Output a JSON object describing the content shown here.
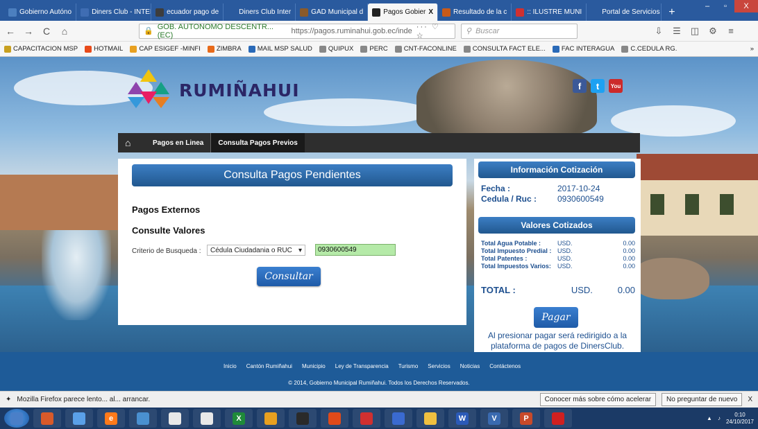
{
  "browser": {
    "tabs": [
      {
        "label": "Gobierno Autóno",
        "color": "#4c7fbf"
      },
      {
        "label": "Diners Club - INTERD",
        "color": "#3f6db3"
      },
      {
        "label": "ecuador pago de",
        "color": "#3d3d3d"
      },
      {
        "label": "Diners Club Inter",
        "color": "#2a5a9e"
      },
      {
        "label": "GAD Municipal d",
        "color": "#8a5a2a"
      },
      {
        "label": "Pagos Gobier",
        "color": "#222222"
      },
      {
        "label": "Resultado de la c",
        "color": "#c85a1a"
      },
      {
        "label": ":: ILUSTRE MUNI",
        "color": "#d03030"
      },
      {
        "label": "Portal de Servicios C",
        "color": "#2a5a9e"
      }
    ],
    "active_tab_close": "X",
    "new_tab": "+",
    "window_controls": [
      "–",
      "▫",
      "X"
    ],
    "back": "←",
    "forward": "→",
    "reload": "C",
    "home": "⌂",
    "url_org": "GOB. AUTONOMO DESCENTR... (EC)",
    "url": "https://pagos.ruminahui.gob.ec/inde",
    "url_actions": "··· ♡ ☆",
    "search_placeholder": "Buscar",
    "bookmarks": [
      {
        "label": "CAPACITACION MSP",
        "color": "#c8a020"
      },
      {
        "label": "HOTMAIL",
        "color": "#e84a1a"
      },
      {
        "label": "CAP ESIGEF -MINFI",
        "color": "#e8a020"
      },
      {
        "label": "ZIMBRA",
        "color": "#e86a1a"
      },
      {
        "label": "MAIL MSP SALUD",
        "color": "#2a6ab8"
      },
      {
        "label": "QUIPUX",
        "color": "#888888"
      },
      {
        "label": "PERC",
        "color": "#888888"
      },
      {
        "label": "CNT-FACONLINE",
        "color": "#888888"
      },
      {
        "label": "CONSULTA FACT ELE...",
        "color": "#888888"
      },
      {
        "label": "FAC INTERAGUA",
        "color": "#2a6ab8"
      },
      {
        "label": "C.CEDULA RG.",
        "color": "#888888"
      }
    ],
    "more": "»"
  },
  "site": {
    "logo_text": "RUMIÑAHUI",
    "social": [
      {
        "label": "f",
        "color": "#3b5998"
      },
      {
        "label": "t",
        "color": "#1da1f2"
      },
      {
        "label": "You",
        "color": "#cc2a2a"
      }
    ],
    "menu": {
      "home_icon": "⌂",
      "items": [
        "Pagos en Linea",
        "Consulta Pagos Previos"
      ]
    },
    "card": {
      "title": "Consulta Pagos Pendientes",
      "heading1": "Pagos Externos",
      "heading2": "Consulte Valores",
      "criterio_label": "Criterio de Busqueda :",
      "select_value": "Cédula Ciudadania o RUC",
      "input_value": "0930600549",
      "button": "Consultar"
    },
    "side": {
      "info_title": "Información Cotización",
      "fecha_label": "Fecha :",
      "fecha_value": "2017-10-24",
      "cedula_label": "Cedula / Ruc :",
      "cedula_value": "0930600549",
      "valores_title": "Valores Cotizados",
      "rows": [
        {
          "name": "Total Agua Potable :",
          "cur": "USD.",
          "val": "0.00"
        },
        {
          "name": "Total Impuesto Predial :",
          "cur": "USD.",
          "val": "0.00"
        },
        {
          "name": "Total Patentes :",
          "cur": "USD.",
          "val": "0.00"
        },
        {
          "name": "Total Impuestos Varios:",
          "cur": "USD.",
          "val": "0.00"
        }
      ],
      "total_label": "TOTAL :",
      "total_cur": "USD.",
      "total_val": "0.00",
      "pay_button": "Pagar",
      "note": "Al presionar pagar será redirigido a la plataforma de pagos de DinersClub."
    },
    "footer": {
      "links": [
        "Inicio",
        "Cantón Rumiñahui",
        "Municipio",
        "Ley de Transparencia",
        "Turismo",
        "Servicios",
        "Noticias",
        "Contáctenos"
      ],
      "copyright": "© 2014, Gobierno Municipal Rumiñahui. Todos los Derechos Reservados."
    }
  },
  "notification": {
    "text": "Mozilla Firefox parece lento... al... arrancar.",
    "btn_learn": "Conocer más sobre cómo acelerar",
    "btn_dismiss": "No preguntar de nuevo",
    "close": "X"
  },
  "taskbar": {
    "apps": [
      "",
      "",
      "",
      "e",
      "",
      "",
      "",
      "X",
      "",
      "",
      "",
      "",
      "",
      "",
      "W",
      "V",
      "P",
      ""
    ],
    "clock_time": "0:10",
    "clock_date": "24/10/2017"
  }
}
